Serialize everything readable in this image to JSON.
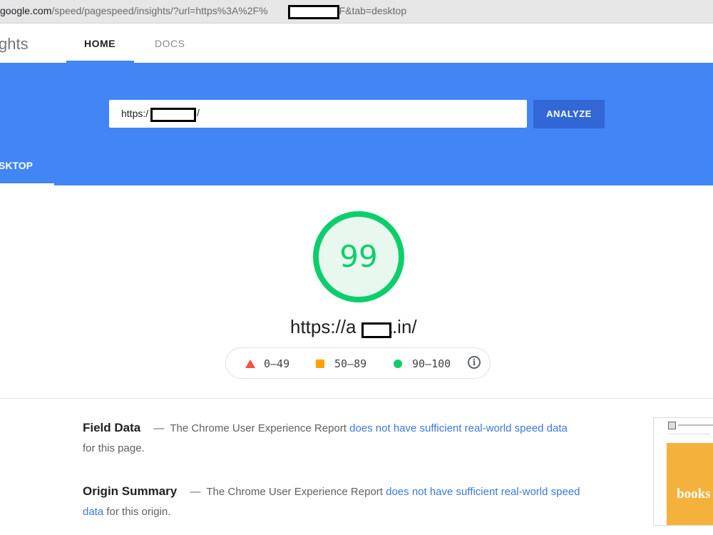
{
  "browser": {
    "url_host": "google.com",
    "url_path": "/speed/pagespeed/insights/?url=https%3A%2F%",
    "url_tail": "n%2F&tab=desktop"
  },
  "nav": {
    "brand": "ghts",
    "tabs": [
      {
        "label": "HOME",
        "active": true
      },
      {
        "label": "DOCS",
        "active": false
      }
    ]
  },
  "search": {
    "url_prefix": "https:/",
    "url_suffix": "/",
    "analyze_label": "ANALYZE"
  },
  "device_tab": {
    "label": "SKTOP"
  },
  "score": {
    "value": "99",
    "fraction": 0.99,
    "color": "#0cce6b",
    "tested_url_prefix": "https://a",
    "tested_url_suffix": "a.in/"
  },
  "legend": {
    "items": [
      {
        "range": "0–49",
        "shape": "triangle",
        "color": "#ff4e42"
      },
      {
        "range": "50–89",
        "shape": "square",
        "color": "#ffa400"
      },
      {
        "range": "90–100",
        "shape": "circle",
        "color": "#0cce6b"
      }
    ],
    "info_icon": "i"
  },
  "field_data": {
    "title": "Field Data",
    "dash": "—",
    "text_before": "The Chrome User Experience Report",
    "link": "does not have sufficient real-world speed data",
    "text_after": "for this page."
  },
  "origin_summary": {
    "title": "Origin Summary",
    "dash": "—",
    "text_before": "The Chrome User Experience Report",
    "link": "does not have sufficient real-world speed data",
    "text_after": "for this origin."
  },
  "thumbnail": {
    "text": "books"
  }
}
